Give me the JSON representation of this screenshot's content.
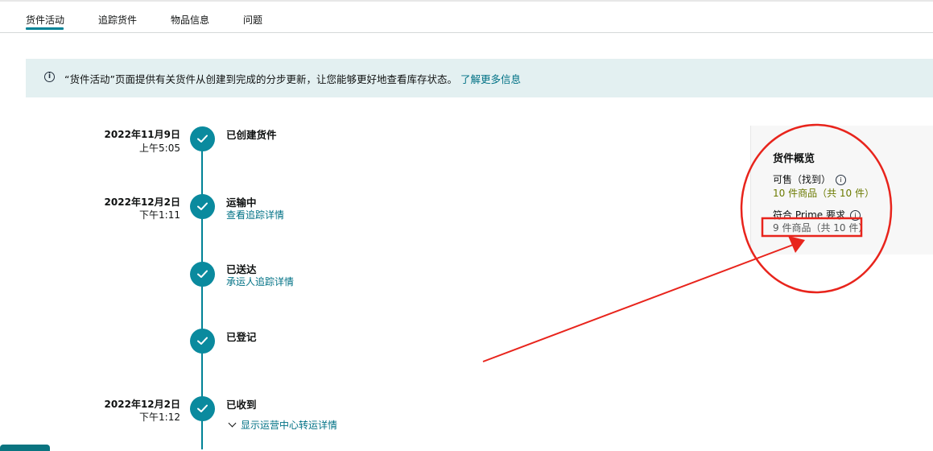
{
  "tabs": [
    "货件活动",
    "追踪货件",
    "物品信息",
    "问题"
  ],
  "banner": {
    "info_icon": "info-icon",
    "message": "“货件活动”页面提供有关货件从创建到完成的分步更新，让您能够更好地查看库存状态。",
    "link": "了解更多信息"
  },
  "timeline": [
    {
      "date": "2022年11月9日",
      "time": "上午5:05",
      "title": "已创建货件",
      "link": ""
    },
    {
      "date": "2022年12月2日",
      "time": "下午1:11",
      "title": "运输中",
      "link": "查看追踪详情"
    },
    {
      "date": "",
      "time": "",
      "title": "已送达",
      "link": "承运人追踪详情"
    },
    {
      "date": "",
      "time": "",
      "title": "已登记",
      "link": ""
    },
    {
      "date": "2022年12月2日",
      "time": "下午1:12",
      "title": "已收到",
      "link": ""
    }
  ],
  "expand_link": "显示运营中心转运详情",
  "summary": {
    "title": "货件概览",
    "sellable_label": "可售（找到）",
    "sellable_value": "10 件商品（共 10 件）",
    "prime_label": "符合 Prime 要求",
    "prime_value": "9 件商品（共 10 件）"
  },
  "colors": {
    "accent": "#008296",
    "annotation": "#e8241c"
  }
}
